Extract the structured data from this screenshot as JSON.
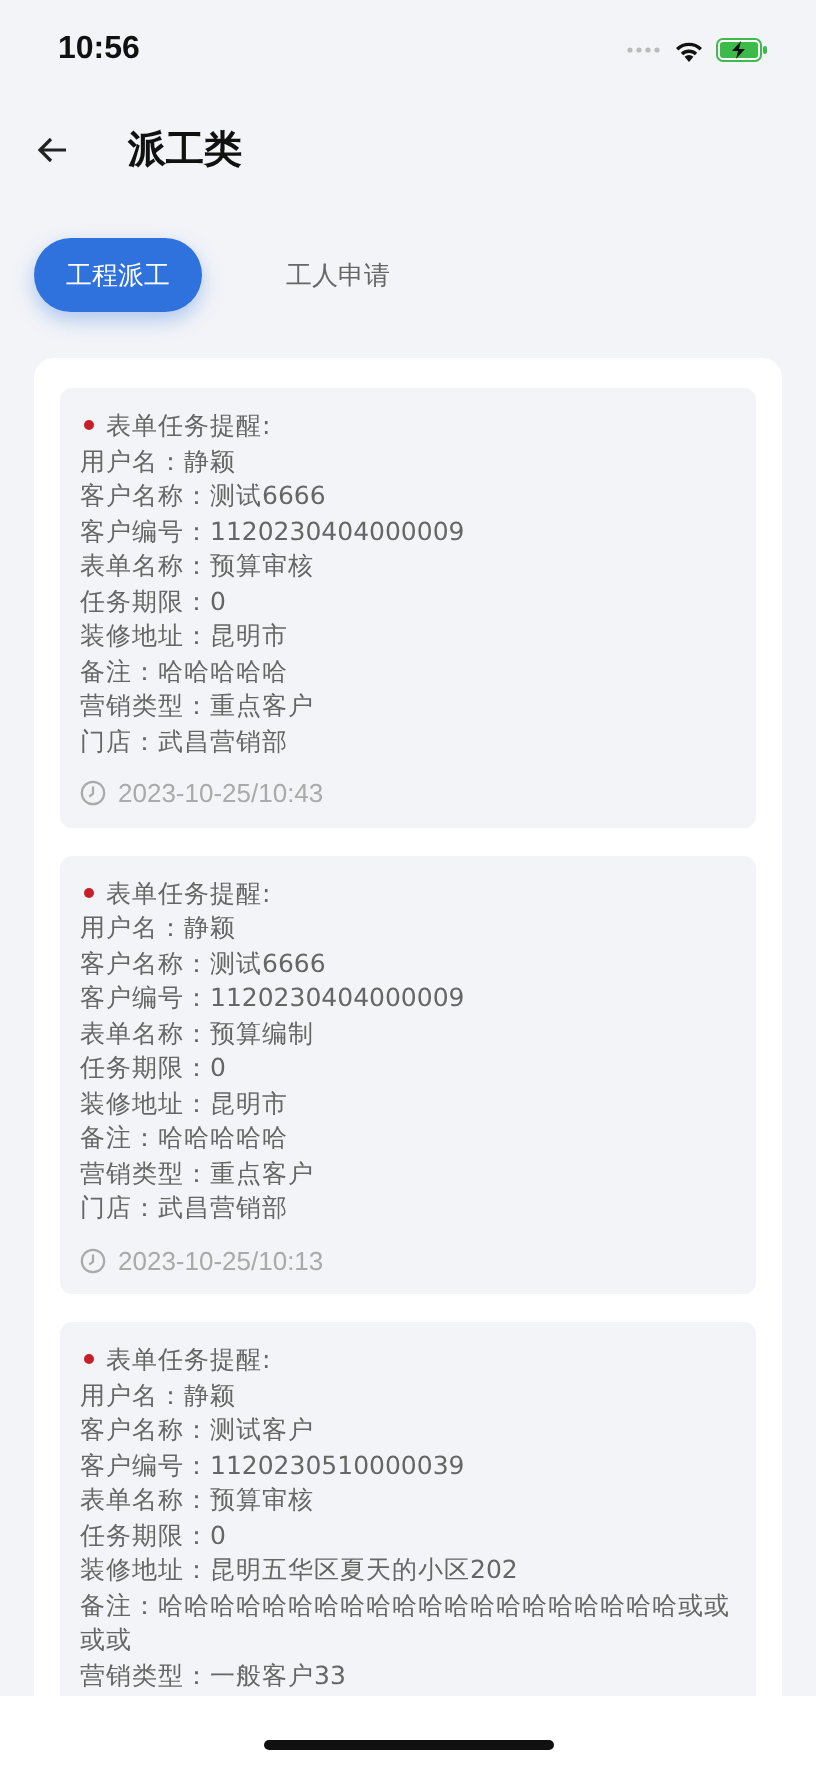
{
  "status_bar": {
    "time": "10:56"
  },
  "header": {
    "title": "派工类"
  },
  "tabs": [
    {
      "label": "工程派工",
      "selected": true
    },
    {
      "label": "工人申请",
      "selected": false
    }
  ],
  "cards": [
    {
      "heading": "表单任务提醒:",
      "unread": true,
      "lines": [
        "用户名：静颖",
        "客户名称：测试6666",
        "客户编号：1120230404000009",
        "表单名称：预算审核",
        "任务期限：0",
        "装修地址：昆明市",
        "备注：哈哈哈哈哈",
        "营销类型：重点客户",
        "门店：武昌营销部"
      ],
      "time": "2023-10-25/10:43"
    },
    {
      "heading": "表单任务提醒:",
      "unread": true,
      "lines": [
        "用户名：静颖",
        "客户名称：测试6666",
        "客户编号：1120230404000009",
        "表单名称：预算编制",
        "任务期限：0",
        "装修地址：昆明市",
        "备注：哈哈哈哈哈",
        "营销类型：重点客户",
        "门店：武昌营销部"
      ],
      "time": "2023-10-25/10:13"
    },
    {
      "heading": "表单任务提醒:",
      "unread": true,
      "lines": [
        "用户名：静颖",
        "客户名称：测试客户",
        "客户编号：1120230510000039",
        "表单名称：预算审核",
        "任务期限：0",
        "装修地址：昆明五华区夏天的小区202",
        "备注：哈哈哈哈哈哈哈哈哈哈哈哈哈哈哈哈哈哈哈哈或或或或",
        "营销类型：一般客户33"
      ]
    }
  ]
}
